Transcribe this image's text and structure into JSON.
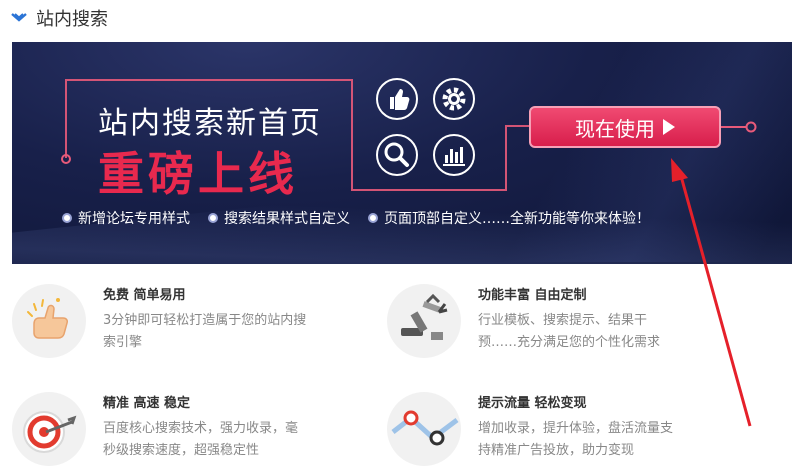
{
  "header": {
    "title": "站内搜索"
  },
  "banner": {
    "line1": "站内搜索新首页",
    "line2": "重磅上线",
    "cta_label": "现在使用",
    "features": [
      "新增论坛专用样式",
      "搜索结果样式自定义",
      "页面顶部自定义……全新功能等你来体验！"
    ],
    "icons": [
      "thumbs-up-icon",
      "gear-icon",
      "magnifier-icon",
      "bar-chart-icon"
    ],
    "colors": {
      "bg": "#18204a",
      "headline_red": "#e8294e",
      "cta": "#e02a55"
    }
  },
  "cards": [
    {
      "title": "免费 简单易用",
      "desc": "3分钟即可轻松打造属于您的站内搜索引擎",
      "icon": "thumbs-up-icon"
    },
    {
      "title": "功能丰富 自由定制",
      "desc": "行业模板、搜索提示、结果干预……充分满足您的个性化需求",
      "icon": "robot-arm-icon"
    },
    {
      "title": "精准 高速 稳定",
      "desc": "百度核心搜索技术，强力收录，毫秒级搜索速度，超强稳定性",
      "icon": "target-icon"
    },
    {
      "title": "提示流量 轻松变现",
      "desc": "增加收录，提升体验，盘活流量支持精准广告投放，助力变现",
      "icon": "line-chart-icon"
    }
  ],
  "annotation": {
    "arrow_color": "#e5202a"
  }
}
